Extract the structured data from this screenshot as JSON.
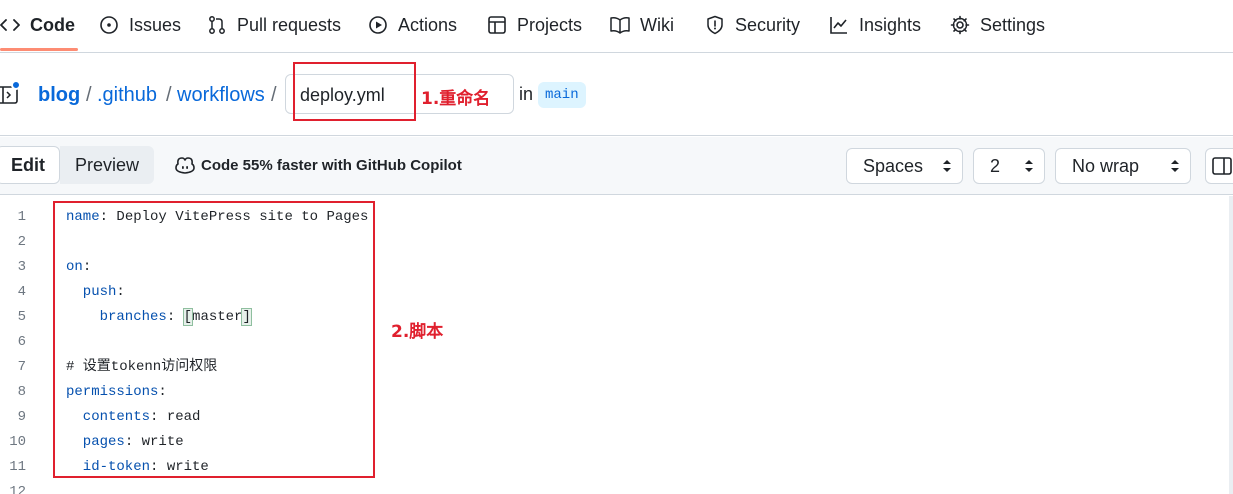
{
  "nav": {
    "items": [
      {
        "label": "Code",
        "icon": "code-icon"
      },
      {
        "label": "Issues",
        "icon": "issue-icon"
      },
      {
        "label": "Pull requests",
        "icon": "pull-request-icon"
      },
      {
        "label": "Actions",
        "icon": "play-icon"
      },
      {
        "label": "Projects",
        "icon": "table-icon"
      },
      {
        "label": "Wiki",
        "icon": "book-icon"
      },
      {
        "label": "Security",
        "icon": "shield-icon"
      },
      {
        "label": "Insights",
        "icon": "graph-icon"
      },
      {
        "label": "Settings",
        "icon": "gear-icon"
      }
    ],
    "accent_color": "#fd8c73"
  },
  "breadcrumb": {
    "repo": "blog",
    "sep": "/",
    "folder1": ".github",
    "folder2": "workflows",
    "filename": "deploy.yml",
    "in_label": "in",
    "branch": "main"
  },
  "annotations": {
    "rename": "1.重命名",
    "script": "2.脚本",
    "color": "#e0202e"
  },
  "toolbar": {
    "edit": "Edit",
    "preview": "Preview",
    "copilot": "Code 55% faster with GitHub Copilot",
    "indent_mode": "Spaces",
    "indent_size": "2",
    "wrap_mode": "No wrap"
  },
  "code": {
    "lines": [
      {
        "n": "1",
        "key": "name",
        "rest": ": Deploy VitePress site to Pages"
      },
      {
        "n": "2",
        "key": "",
        "rest": ""
      },
      {
        "n": "3",
        "key": "on",
        "rest": ":"
      },
      {
        "n": "4",
        "key": "  push",
        "rest": ":"
      },
      {
        "n": "5",
        "key": "    branches",
        "rest": ": ",
        "bracket_open": "[",
        "value": "master",
        "bracket_close": "]"
      },
      {
        "n": "6",
        "key": "",
        "rest": ""
      },
      {
        "n": "7",
        "key": "",
        "rest": "# 设置tokenn访问权限"
      },
      {
        "n": "8",
        "key": "permissions",
        "rest": ":"
      },
      {
        "n": "9",
        "key": "  contents",
        "rest": ": read"
      },
      {
        "n": "10",
        "key": "  pages",
        "rest": ": write"
      },
      {
        "n": "11",
        "key": "  id-token",
        "rest": ": write"
      },
      {
        "n": "12",
        "key": "",
        "rest": ""
      }
    ]
  }
}
